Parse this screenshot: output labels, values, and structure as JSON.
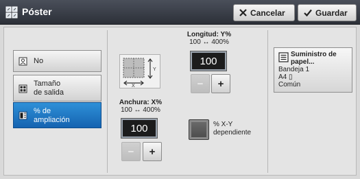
{
  "window": {
    "title": "Póster",
    "icon": "poster-icon"
  },
  "toolbar": {
    "cancel_label": "Cancelar",
    "save_label": "Guardar"
  },
  "options": [
    {
      "label": "No",
      "icon": "none-icon",
      "selected": false
    },
    {
      "label": "Tamaño\nde salida",
      "icon": "output-size-icon",
      "selected": false
    },
    {
      "label": "% de\nampliación",
      "icon": "enlargement-icon",
      "selected": true
    }
  ],
  "length": {
    "title": "Longitud: Y%",
    "range": "100 ↔ 400%",
    "value": "100",
    "minus": "−",
    "plus": "+"
  },
  "width": {
    "title": "Anchura: X%",
    "range": "100 ↔ 400%",
    "value": "100",
    "minus": "−",
    "plus": "+"
  },
  "xy_dependent": {
    "label_line1": "% X-Y",
    "label_line2": "dependiente"
  },
  "paper_supply": {
    "title_line1": "Suministro de",
    "title_line2": "papel...",
    "tray": "Bandeja 1",
    "size": "A4 ▯",
    "type": "Común"
  },
  "colors": {
    "selected": "#1f78c8",
    "titlebar": "#363a43"
  }
}
